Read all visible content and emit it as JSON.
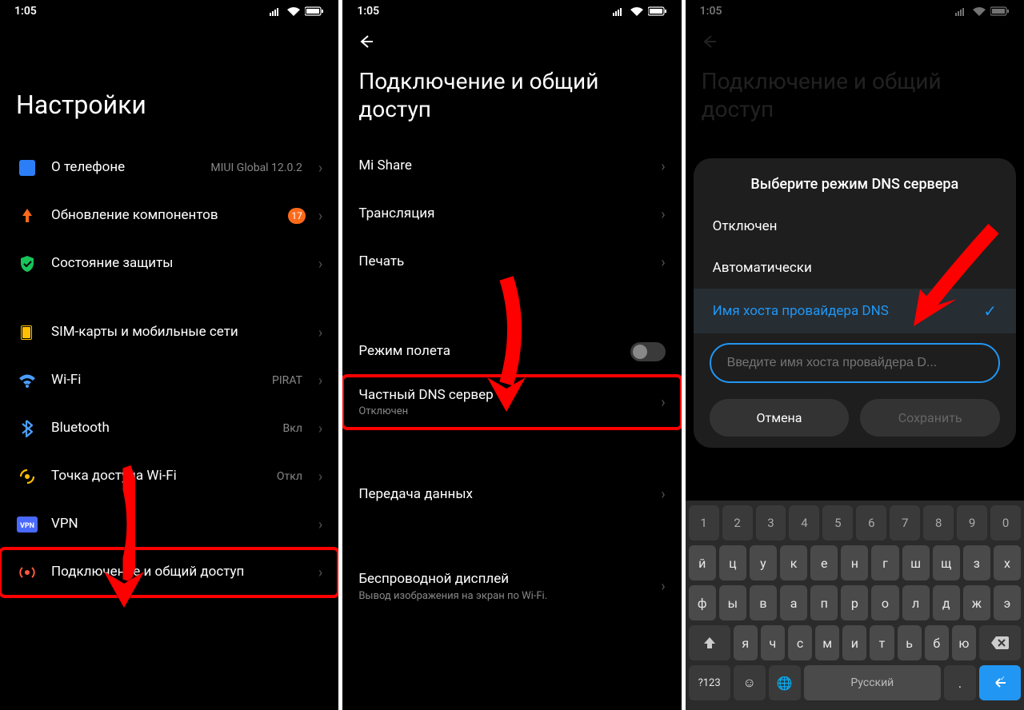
{
  "status": {
    "time": "1:05"
  },
  "screen1": {
    "title": "Настройки",
    "items": [
      {
        "label": "О телефоне",
        "side": "MIUI Global 12.0.2",
        "icon": "about",
        "color": "#2c7ef7"
      },
      {
        "label": "Обновление компонентов",
        "badge": "17",
        "icon": "update",
        "color": "#ff6a1a"
      },
      {
        "label": "Состояние защиты",
        "icon": "shield",
        "color": "#18c35a"
      }
    ],
    "items2": [
      {
        "label": "SIM-карты и мобильные сети",
        "icon": "sim",
        "color": "#ffbf00"
      },
      {
        "label": "Wi-Fi",
        "side": "PIRAT",
        "icon": "wifi",
        "color": "#4a9eff"
      },
      {
        "label": "Bluetooth",
        "side": "Вкл",
        "icon": "bt",
        "color": "#4a9eff"
      },
      {
        "label": "Точка доступа Wi-Fi",
        "side": "Откл",
        "icon": "hotspot",
        "color": "#ffbf00"
      },
      {
        "label": "VPN",
        "icon": "vpn",
        "color": "#4a6aff"
      },
      {
        "label": "Подключение и общий доступ",
        "icon": "share",
        "color": "#ff5a3c",
        "highlight": true
      }
    ]
  },
  "screen2": {
    "title": "Подключение и общий доступ",
    "group1": [
      {
        "label": "Mi Share"
      },
      {
        "label": "Трансляция"
      },
      {
        "label": "Печать"
      }
    ],
    "airplane": {
      "label": "Режим полета"
    },
    "dns": {
      "label": "Частный DNS сервер",
      "sub": "Отключен",
      "highlight": true
    },
    "group2": [
      {
        "label": "Передача данных"
      }
    ],
    "wireless": {
      "label": "Беспроводной дисплей",
      "sub": "Вывод изображения на экран по Wi-Fi."
    }
  },
  "screen3": {
    "title": "Подключение и общий доступ",
    "sheet": {
      "title": "Выберите режим DNS сервера",
      "options": [
        {
          "label": "Отключен"
        },
        {
          "label": "Автоматически"
        },
        {
          "label": "Имя хоста провайдера DNS",
          "selected": true
        }
      ],
      "placeholder": "Введите имя хоста провайдера D...",
      "cancel": "Отмена",
      "save": "Сохранить"
    },
    "keyboard": {
      "row0": [
        "1",
        "2",
        "3",
        "4",
        "5",
        "6",
        "7",
        "8",
        "9",
        "0"
      ],
      "row1": [
        "й",
        "ц",
        "у",
        "к",
        "е",
        "н",
        "г",
        "ш",
        "щ",
        "з",
        "х"
      ],
      "row2": [
        "ф",
        "ы",
        "в",
        "а",
        "п",
        "р",
        "о",
        "л",
        "д",
        "ж",
        "э"
      ],
      "row3": [
        "я",
        "ч",
        "с",
        "м",
        "и",
        "т",
        "ь",
        "б",
        "ю"
      ],
      "lang": "Русский",
      "sym": "?123"
    }
  }
}
